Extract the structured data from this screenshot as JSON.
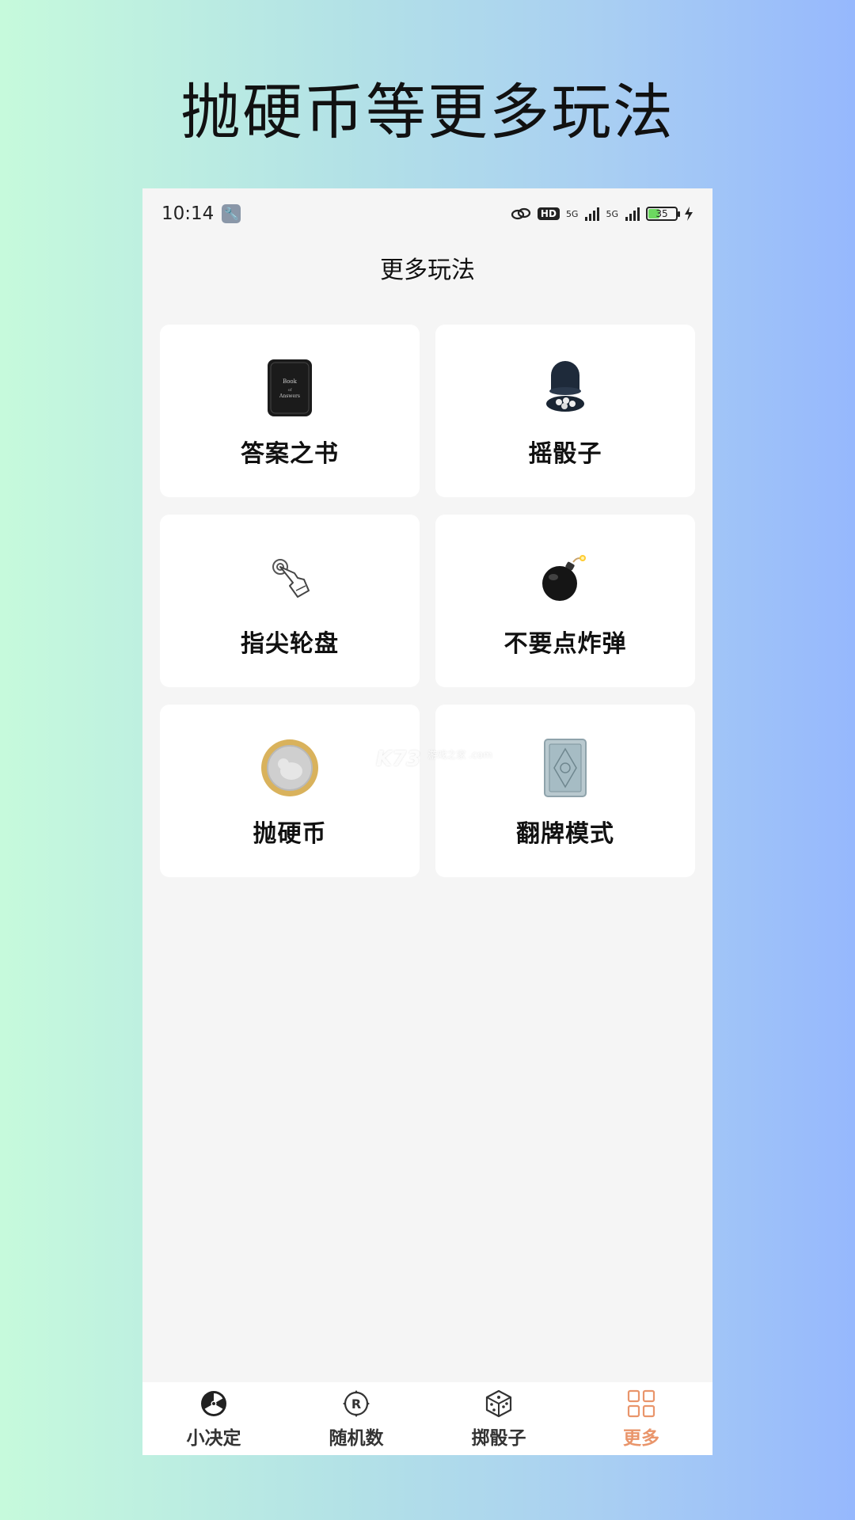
{
  "promo": {
    "title": "抛硬币等更多玩法"
  },
  "status_bar": {
    "time": "10:14",
    "hd_badge": "HD",
    "network_1": "5G",
    "network_2": "5G",
    "battery_level": "35",
    "icons": [
      "wrench-icon",
      "link-icon",
      "hd-icon",
      "signal-icon",
      "signal-icon",
      "battery-icon",
      "charging-icon"
    ]
  },
  "header": {
    "title": "更多玩法"
  },
  "cards": [
    {
      "label": "答案之书",
      "icon": "book-icon"
    },
    {
      "label": "摇骰子",
      "icon": "dice-cup-icon"
    },
    {
      "label": "指尖轮盘",
      "icon": "finger-tap-icon"
    },
    {
      "label": "不要点炸弹",
      "icon": "bomb-icon"
    },
    {
      "label": "抛硬币",
      "icon": "coin-icon"
    },
    {
      "label": "翻牌模式",
      "icon": "card-back-icon"
    }
  ],
  "watermark": {
    "text": "K73",
    "sub": "游戏之家 .com"
  },
  "tab_bar": {
    "tabs": [
      {
        "label": "小决定",
        "icon": "radiation-icon",
        "active": false
      },
      {
        "label": "随机数",
        "icon": "random-r-icon",
        "active": false
      },
      {
        "label": "掷骰子",
        "icon": "dice-icon",
        "active": false
      },
      {
        "label": "更多",
        "icon": "grid-icon",
        "active": true
      }
    ]
  },
  "colors": {
    "accent": "#e9956b",
    "page_background": "#f5f5f5",
    "card_background": "#ffffff"
  }
}
